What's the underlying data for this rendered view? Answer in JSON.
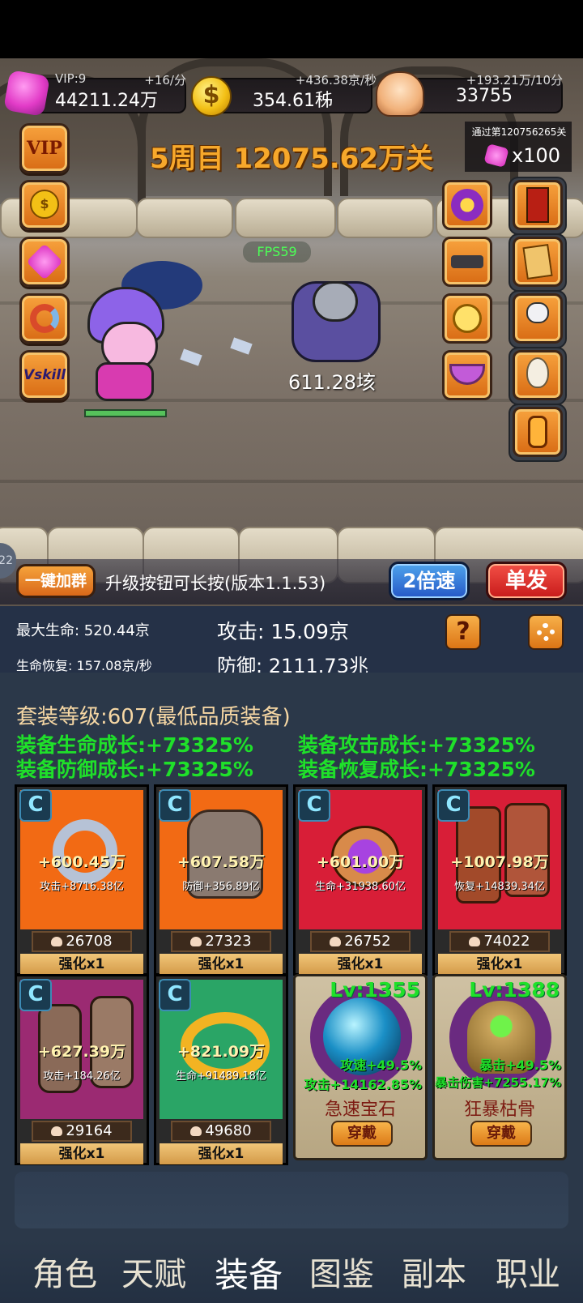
{
  "resources": {
    "gem": {
      "vip": "VIP:9",
      "rate": "+16/分",
      "value": "44211.24万"
    },
    "coin": {
      "rate": "+436.38京/秒",
      "value": "354.61秭"
    },
    "skull": {
      "rate": "+193.21万/10分",
      "value": "33755"
    }
  },
  "pass_reward": {
    "label": "通过第120756265关",
    "amount": "x100"
  },
  "stage_title": "5周目 12075.62万关",
  "left_buttons": {
    "vip": "VIP",
    "skill": "Vskill"
  },
  "fps": "FPS59",
  "damage_text": "611.28垓",
  "bottom_bar": {
    "join_group": "一键加群",
    "hint": "升级按钮可长按(版本1.1.53)",
    "speed": "2倍速",
    "fire_mode": "单发",
    "side_tab": "22"
  },
  "stats": {
    "max_hp": "最大生命:  520.44京",
    "hp_regen": "生命恢复:  157.08京/秒",
    "attack": "攻击:  15.09京",
    "defense": "防御:  2111.73兆",
    "help": "?"
  },
  "set": {
    "level": "套装等级:607(最低品质装备)",
    "growth": [
      "装备生命成长:+73325%",
      "装备攻击成长:+73325%",
      "装备防御成长:+73325%",
      "装备恢复成长:+73325%"
    ]
  },
  "equipment": [
    {
      "bonus": "+600.45万",
      "sub": "攻击+8716.38亿",
      "cost": "26708",
      "action": "强化x1",
      "color": "#f26a14"
    },
    {
      "bonus": "+607.58万",
      "sub": "防御+356.89亿",
      "cost": "27323",
      "action": "强化x1",
      "color": "#f26a14"
    },
    {
      "bonus": "+601.00万",
      "sub": "生命+31938.60亿",
      "cost": "26752",
      "action": "强化x1",
      "color": "#d81e37"
    },
    {
      "bonus": "+1007.98万",
      "sub": "恢复+14839.34亿",
      "cost": "74022",
      "action": "强化x1",
      "color": "#d81e37"
    },
    {
      "bonus": "+627.39万",
      "sub": "攻击+184.26亿",
      "cost": "29164",
      "action": "强化x1",
      "color": "#9b2a72"
    },
    {
      "bonus": "+821.09万",
      "sub": "生命+91489.18亿",
      "cost": "49680",
      "action": "强化x1",
      "color": "#2aa566"
    }
  ],
  "gems": [
    {
      "level": "Lv:1355",
      "line1": "攻速+49.5%",
      "line2": "攻击+14162.85%",
      "name": "急速宝石",
      "action": "穿戴"
    },
    {
      "level": "Lv:1388",
      "line1": "暴击+49.5%",
      "line2": "暴击伤害+7255.17%",
      "name": "狂暴枯骨",
      "action": "穿戴"
    }
  ],
  "nav": [
    "角色",
    "天赋",
    "装备",
    "图鉴",
    "副本",
    "职业"
  ],
  "colors": {
    "accent_orange": "#f29a2e",
    "growth_green": "#1fe02a",
    "panel_blue": "#253147"
  },
  "icons": [
    "gem-icon",
    "coin-icon",
    "skull-icon",
    "help-icon",
    "settings-icon",
    "refresh-icon"
  ]
}
